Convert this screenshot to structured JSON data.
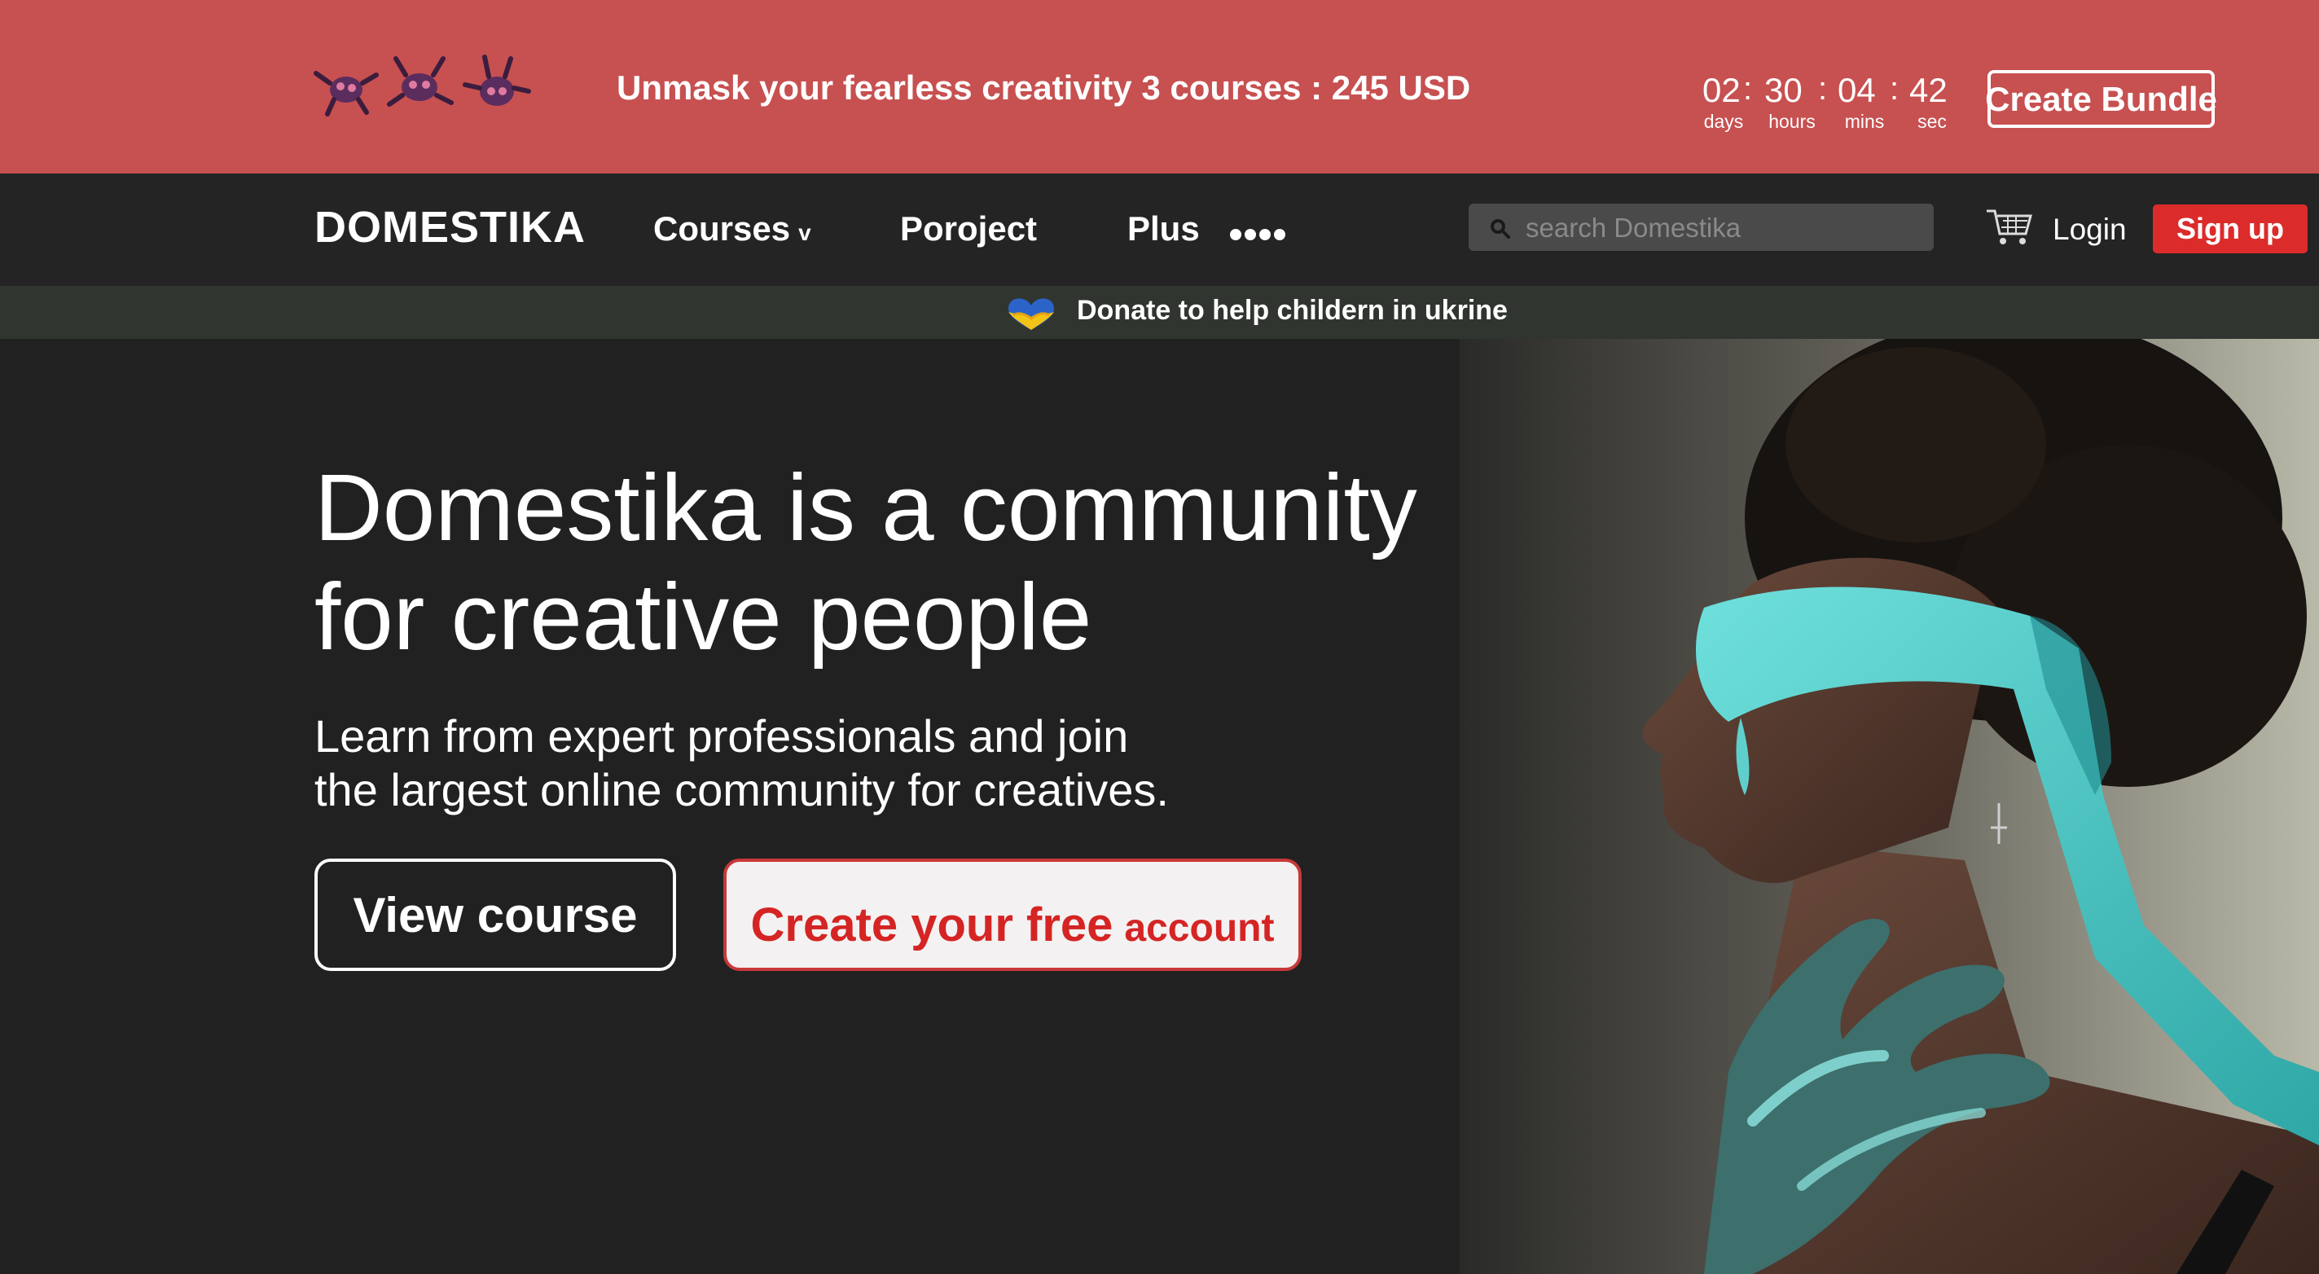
{
  "promo": {
    "message": "Unmask your fearless creativity 3 courses : 245 USD",
    "countdown": {
      "days": "02",
      "hours": "30",
      "mins": "04",
      "sec": "42",
      "days_label": "days",
      "hours_label": "hours",
      "mins_label": "mins",
      "sec_label": "sec"
    },
    "button_label": "Create Bundle",
    "decoration_icons": [
      "mask-figure-icon",
      "mask-figure-icon",
      "mask-figure-icon"
    ],
    "background_color": "#c75050"
  },
  "nav": {
    "logo": "DOMESTIKA",
    "items": [
      {
        "label": "Courses",
        "has_dropdown": true
      },
      {
        "label": "Poroject"
      },
      {
        "label": "Plus"
      }
    ],
    "more_icon": "more-dots-icon",
    "search_placeholder": "search Domestika",
    "cart_icon": "cart-icon",
    "login_label": "Login",
    "signup_label": "Sign up",
    "accent_color": "#dc2b2b"
  },
  "donate": {
    "text": "Donate to help childern in ukrine",
    "icon": "ukraine-heart-icon"
  },
  "hero": {
    "title_line1": "Domestika is a community",
    "title_line2": "for creative people",
    "subtitle_line1": "Learn from expert professionals and join",
    "subtitle_line2": "the largest online community for creatives.",
    "view_course_label": "View course",
    "create_label_main": "Create your free",
    "create_label_small": "account"
  }
}
